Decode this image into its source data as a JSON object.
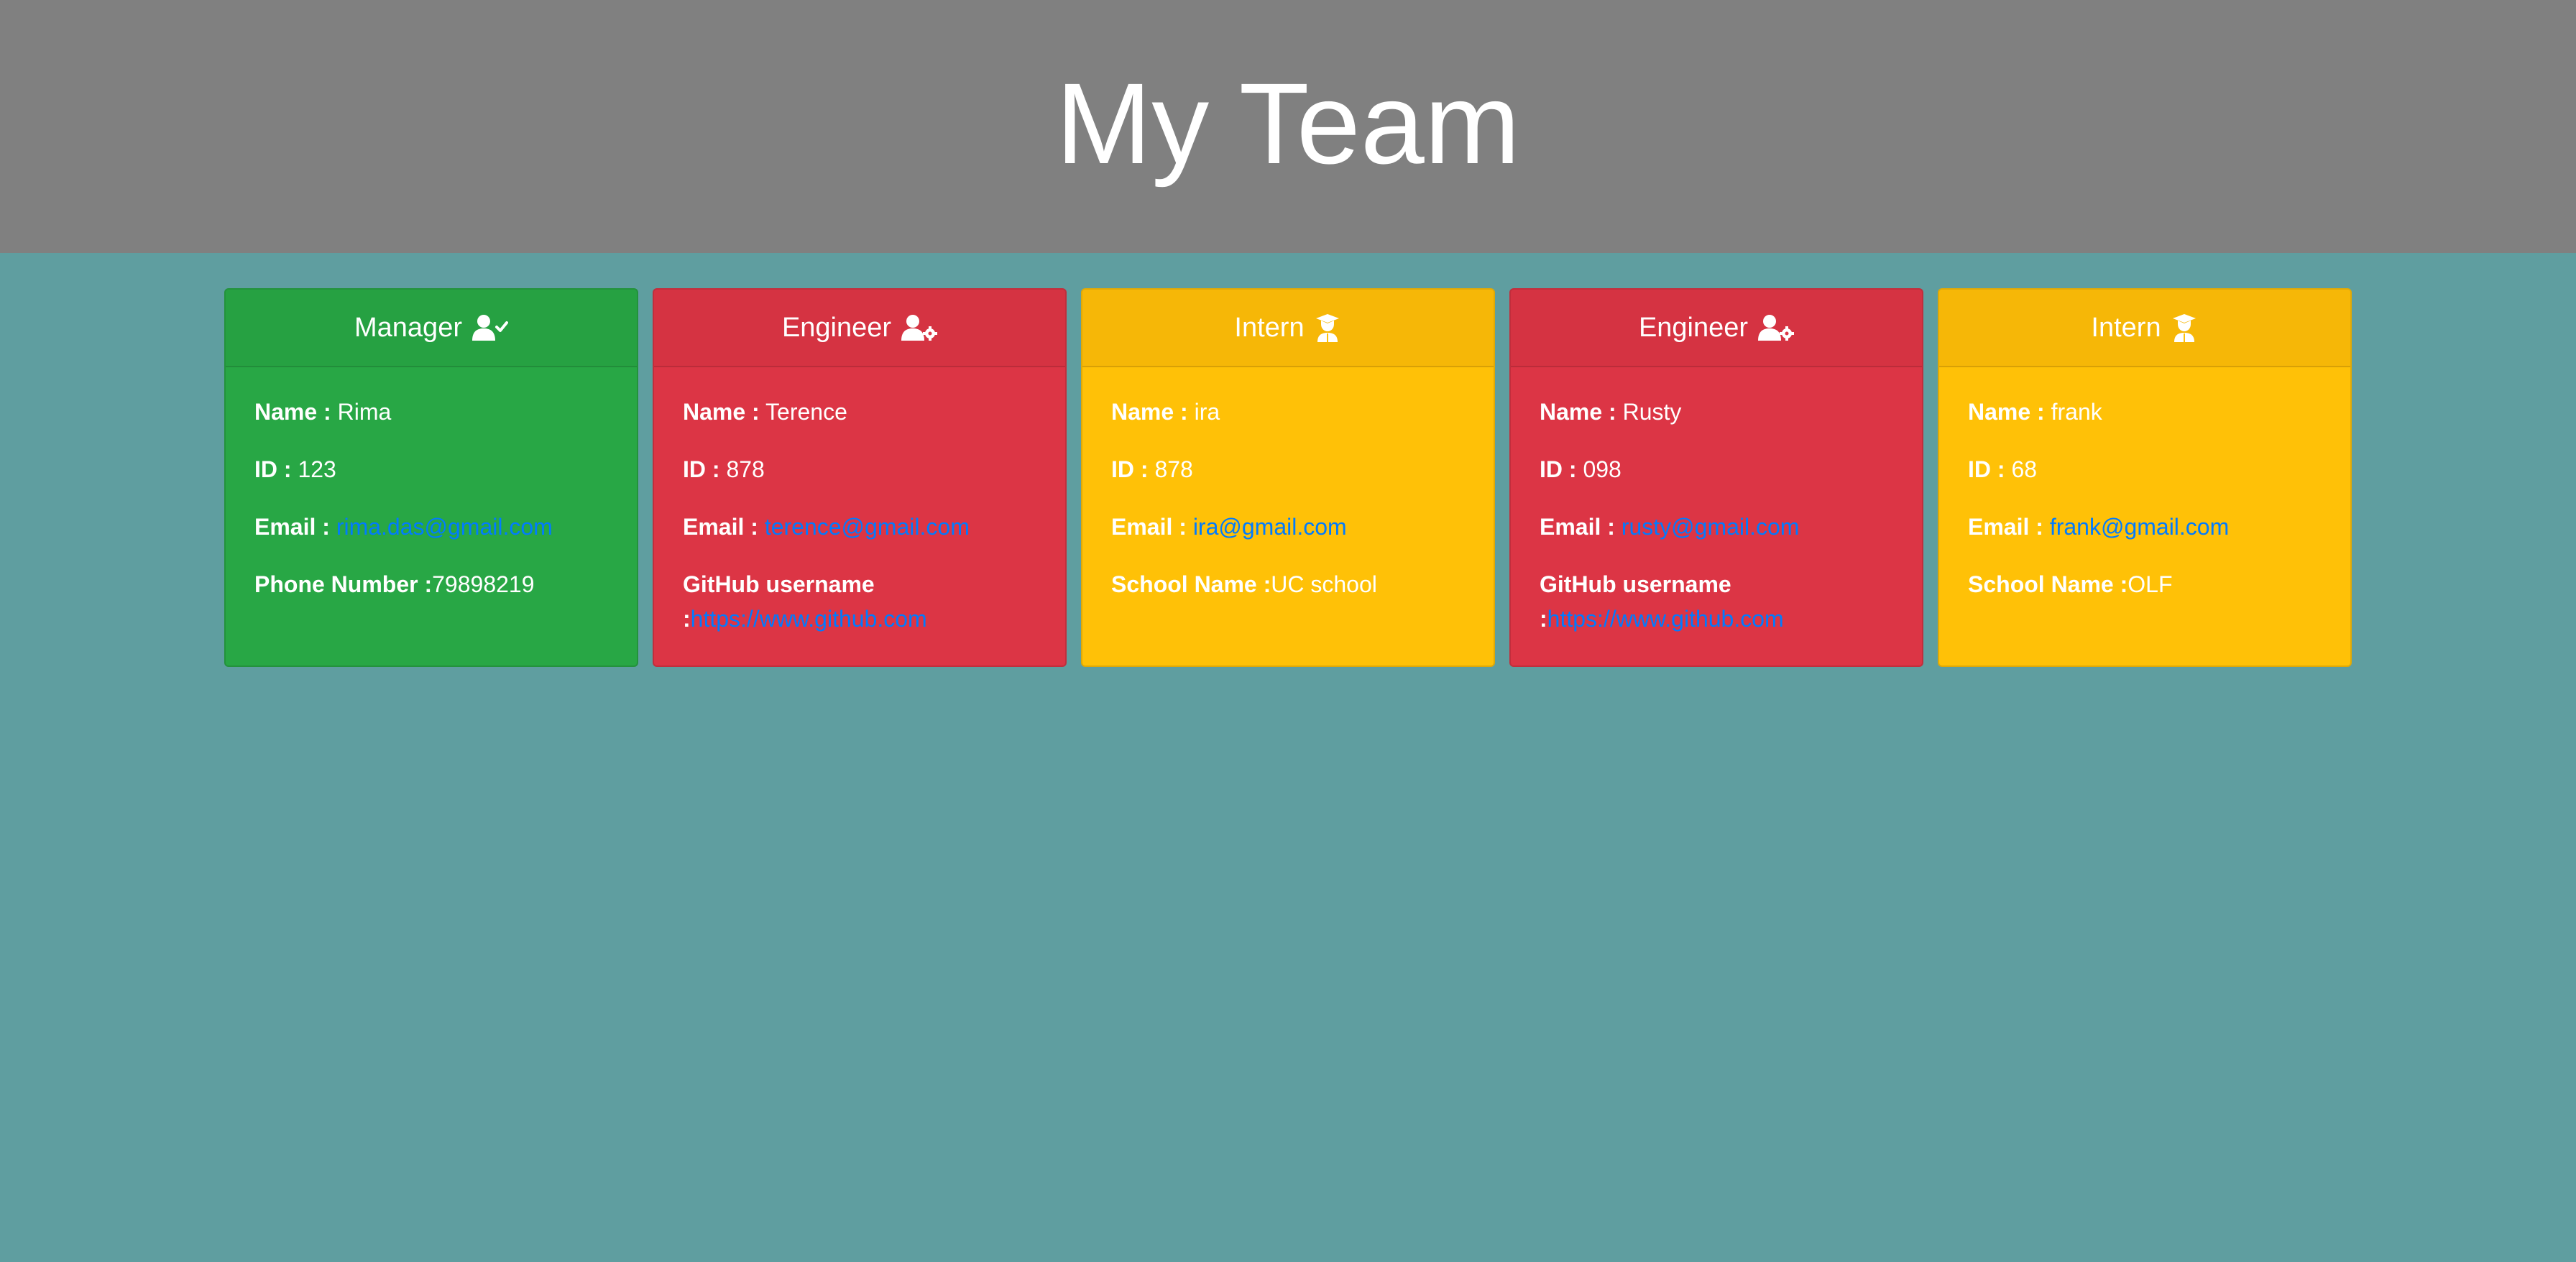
{
  "header": {
    "title": "My Team"
  },
  "cards": [
    {
      "role": "Manager",
      "color": "#28a745",
      "icon": "user-check-icon",
      "fields": {
        "name_label": "Name :",
        "name": "Rima",
        "id_label": "ID :",
        "id": "123",
        "email_label": "Email :",
        "email": "rima.das@gmail.com",
        "extra_label": "Phone Number :",
        "extra": "79898219"
      }
    },
    {
      "role": "Engineer",
      "color": "#dc3545",
      "icon": "user-gear-icon",
      "fields": {
        "name_label": "Name :",
        "name": "Terence",
        "id_label": "ID :",
        "id": "878",
        "email_label": "Email :",
        "email": "terence@gmail.com",
        "extra_label": "GitHub username :",
        "extra": "https://www.github.com"
      }
    },
    {
      "role": "Intern",
      "color": "#ffc107",
      "icon": "user-graduate-icon",
      "fields": {
        "name_label": "Name :",
        "name": "ira",
        "id_label": "ID :",
        "id": "878",
        "email_label": "Email :",
        "email": "ira@gmail.com",
        "extra_label": "School Name :",
        "extra": "UC school"
      }
    },
    {
      "role": "Engineer",
      "color": "#dc3545",
      "icon": "user-gear-icon",
      "fields": {
        "name_label": "Name :",
        "name": "Rusty",
        "id_label": "ID :",
        "id": "098",
        "email_label": "Email :",
        "email": "rusty@gmail.com",
        "extra_label": "GitHub username :",
        "extra": "https://www.github.com"
      }
    },
    {
      "role": "Intern",
      "color": "#ffc107",
      "icon": "user-graduate-icon",
      "fields": {
        "name_label": "Name :",
        "name": "frank",
        "id_label": "ID :",
        "id": "68",
        "email_label": "Email :",
        "email": "frank@gmail.com",
        "extra_label": "School Name :",
        "extra": "OLF"
      }
    }
  ]
}
